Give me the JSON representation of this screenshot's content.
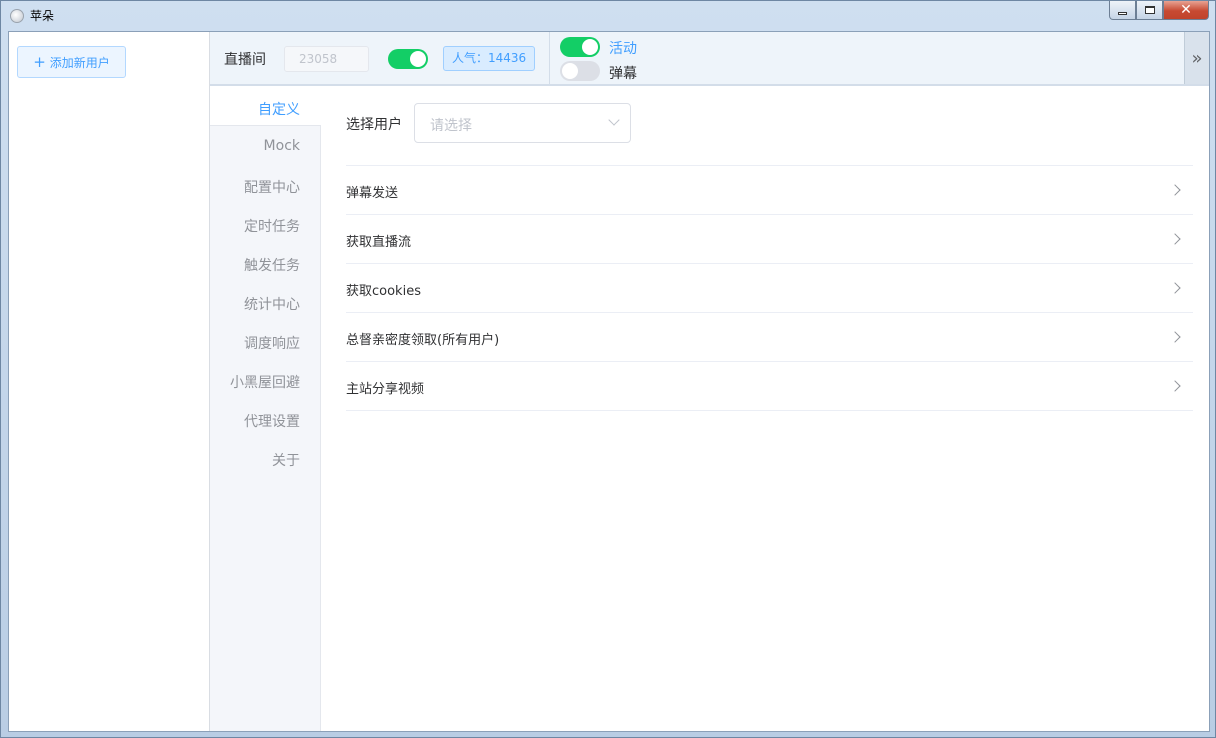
{
  "window": {
    "title": "苹朵"
  },
  "sidebar": {
    "add_user_label": "添加新用户"
  },
  "topbar": {
    "room_label": "直播间",
    "room_id_placeholder": "23058",
    "room_switch_on": true,
    "popularity_label": "人气：14436",
    "activity_label": "活动",
    "activity_on": true,
    "danmaku_label": "弹幕",
    "danmaku_on": false
  },
  "tabs": [
    {
      "label": "自定义",
      "active": true
    },
    {
      "label": "Mock"
    },
    {
      "label": "配置中心"
    },
    {
      "label": "定时任务"
    },
    {
      "label": "触发任务"
    },
    {
      "label": "统计中心"
    },
    {
      "label": "调度响应"
    },
    {
      "label": "小黑屋回避"
    },
    {
      "label": "代理设置"
    },
    {
      "label": "关于"
    }
  ],
  "main": {
    "select_user_label": "选择用户",
    "select_user_placeholder": "请选择",
    "items": [
      {
        "label": "弹幕发送"
      },
      {
        "label": "获取直播流"
      },
      {
        "label": "获取cookies"
      },
      {
        "label": "总督亲密度领取(所有用户)"
      },
      {
        "label": "主站分享视频"
      }
    ]
  },
  "colors": {
    "accent": "#409eff",
    "switch_on": "#13ce66",
    "switch_off": "#dcdfe6"
  }
}
